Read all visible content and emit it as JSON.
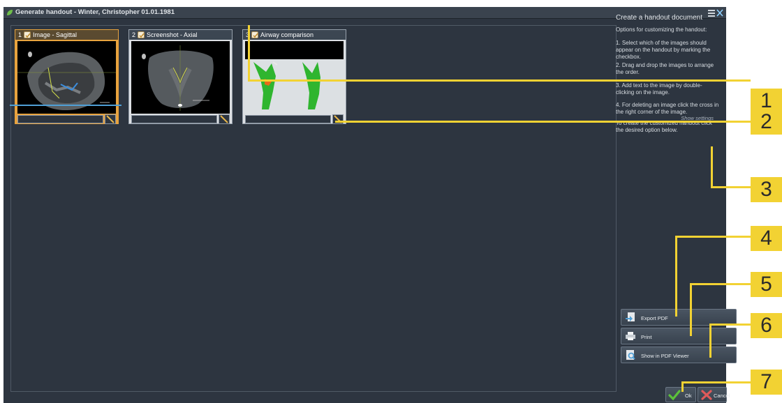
{
  "window": {
    "title": "Generate handout - Winter, Christopher 01.01.1981",
    "app_icon": "green-leaf-icon",
    "controls_icon": "window-controls-icon"
  },
  "cards": [
    {
      "number": "1",
      "label": "Image - Sagittal",
      "selected": true,
      "checked": true,
      "caption": ""
    },
    {
      "number": "2",
      "label": "Screenshot - Axial",
      "selected": false,
      "checked": true,
      "caption": ""
    },
    {
      "number": "3",
      "label": "Airway comparison",
      "selected": false,
      "checked": true,
      "caption": ""
    }
  ],
  "panel": {
    "title": "Create a handout document",
    "subtitle": "Options for customizing the handout:",
    "steps": [
      "1. Select which of the images should appear on the handout by marking the checkbox.",
      "2. Drag and drop the images to arrange the order.",
      "3. Add text to the image by double-clicking on the image.",
      "4. For deleting an image click the cross in the right corner of the image.",
      "To create the customized handout click the desired option below."
    ],
    "show_settings": "Show settings"
  },
  "actions": {
    "export_pdf": "Export PDF",
    "print": "Print",
    "show_pdf": "Show in PDF Viewer"
  },
  "dialog": {
    "ok": "Ok",
    "cancel": "Cancel"
  },
  "callouts": [
    "1",
    "2",
    "3",
    "4",
    "5",
    "6",
    "7"
  ],
  "colors": {
    "background": "#2d3540",
    "selection": "#e8a33e",
    "callout": "#f2d233"
  }
}
